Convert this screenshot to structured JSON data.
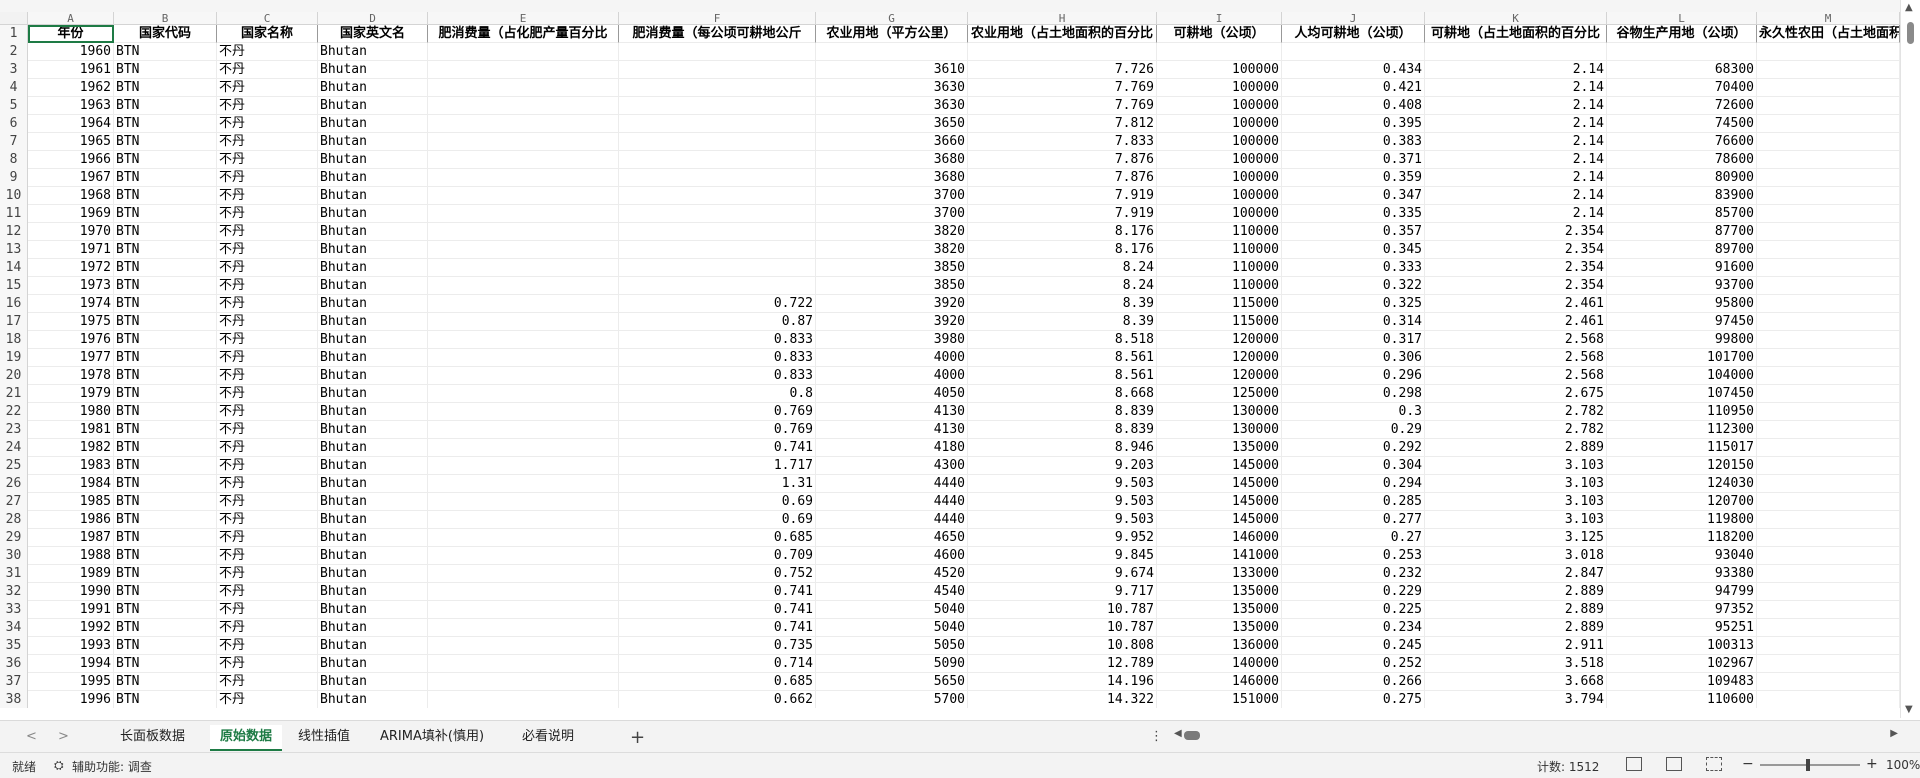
{
  "columns": {
    "letters": [
      "A",
      "B",
      "C",
      "D",
      "E",
      "F",
      "G",
      "H",
      "I",
      "J",
      "K",
      "L",
      "M"
    ],
    "headers": [
      "年份",
      "国家代码",
      "国家名称",
      "国家英文名",
      "肥消费量（占化肥产量百分比",
      "肥消费量（每公顷可耕地公斤",
      "农业用地（平方公里）",
      "农业用地（占土地面积的百分比",
      "可耕地（公顷）",
      "人均可耕地（公顷）",
      "可耕地（占土地面积的百分比",
      "谷物生产用地（公顷）",
      "永久性农田（占土地面积"
    ]
  },
  "rows": [
    [
      "1960",
      "BTN",
      "不丹",
      "Bhutan",
      "",
      "",
      "",
      "",
      "",
      "",
      "",
      "",
      ""
    ],
    [
      "1961",
      "BTN",
      "不丹",
      "Bhutan",
      "",
      "",
      "3610",
      "7.726",
      "100000",
      "0.434",
      "2.14",
      "68300",
      ""
    ],
    [
      "1962",
      "BTN",
      "不丹",
      "Bhutan",
      "",
      "",
      "3630",
      "7.769",
      "100000",
      "0.421",
      "2.14",
      "70400",
      ""
    ],
    [
      "1963",
      "BTN",
      "不丹",
      "Bhutan",
      "",
      "",
      "3630",
      "7.769",
      "100000",
      "0.408",
      "2.14",
      "72600",
      ""
    ],
    [
      "1964",
      "BTN",
      "不丹",
      "Bhutan",
      "",
      "",
      "3650",
      "7.812",
      "100000",
      "0.395",
      "2.14",
      "74500",
      ""
    ],
    [
      "1965",
      "BTN",
      "不丹",
      "Bhutan",
      "",
      "",
      "3660",
      "7.833",
      "100000",
      "0.383",
      "2.14",
      "76600",
      ""
    ],
    [
      "1966",
      "BTN",
      "不丹",
      "Bhutan",
      "",
      "",
      "3680",
      "7.876",
      "100000",
      "0.371",
      "2.14",
      "78600",
      ""
    ],
    [
      "1967",
      "BTN",
      "不丹",
      "Bhutan",
      "",
      "",
      "3680",
      "7.876",
      "100000",
      "0.359",
      "2.14",
      "80900",
      ""
    ],
    [
      "1968",
      "BTN",
      "不丹",
      "Bhutan",
      "",
      "",
      "3700",
      "7.919",
      "100000",
      "0.347",
      "2.14",
      "83900",
      ""
    ],
    [
      "1969",
      "BTN",
      "不丹",
      "Bhutan",
      "",
      "",
      "3700",
      "7.919",
      "100000",
      "0.335",
      "2.14",
      "85700",
      ""
    ],
    [
      "1970",
      "BTN",
      "不丹",
      "Bhutan",
      "",
      "",
      "3820",
      "8.176",
      "110000",
      "0.357",
      "2.354",
      "87700",
      ""
    ],
    [
      "1971",
      "BTN",
      "不丹",
      "Bhutan",
      "",
      "",
      "3820",
      "8.176",
      "110000",
      "0.345",
      "2.354",
      "89700",
      ""
    ],
    [
      "1972",
      "BTN",
      "不丹",
      "Bhutan",
      "",
      "",
      "3850",
      "8.24",
      "110000",
      "0.333",
      "2.354",
      "91600",
      ""
    ],
    [
      "1973",
      "BTN",
      "不丹",
      "Bhutan",
      "",
      "",
      "3850",
      "8.24",
      "110000",
      "0.322",
      "2.354",
      "93700",
      ""
    ],
    [
      "1974",
      "BTN",
      "不丹",
      "Bhutan",
      "",
      "0.722",
      "3920",
      "8.39",
      "115000",
      "0.325",
      "2.461",
      "95800",
      ""
    ],
    [
      "1975",
      "BTN",
      "不丹",
      "Bhutan",
      "",
      "0.87",
      "3920",
      "8.39",
      "115000",
      "0.314",
      "2.461",
      "97450",
      ""
    ],
    [
      "1976",
      "BTN",
      "不丹",
      "Bhutan",
      "",
      "0.833",
      "3980",
      "8.518",
      "120000",
      "0.317",
      "2.568",
      "99800",
      ""
    ],
    [
      "1977",
      "BTN",
      "不丹",
      "Bhutan",
      "",
      "0.833",
      "4000",
      "8.561",
      "120000",
      "0.306",
      "2.568",
      "101700",
      ""
    ],
    [
      "1978",
      "BTN",
      "不丹",
      "Bhutan",
      "",
      "0.833",
      "4000",
      "8.561",
      "120000",
      "0.296",
      "2.568",
      "104000",
      ""
    ],
    [
      "1979",
      "BTN",
      "不丹",
      "Bhutan",
      "",
      "0.8",
      "4050",
      "8.668",
      "125000",
      "0.298",
      "2.675",
      "107450",
      ""
    ],
    [
      "1980",
      "BTN",
      "不丹",
      "Bhutan",
      "",
      "0.769",
      "4130",
      "8.839",
      "130000",
      "0.3",
      "2.782",
      "110950",
      ""
    ],
    [
      "1981",
      "BTN",
      "不丹",
      "Bhutan",
      "",
      "0.769",
      "4130",
      "8.839",
      "130000",
      "0.29",
      "2.782",
      "112300",
      ""
    ],
    [
      "1982",
      "BTN",
      "不丹",
      "Bhutan",
      "",
      "0.741",
      "4180",
      "8.946",
      "135000",
      "0.292",
      "2.889",
      "115017",
      ""
    ],
    [
      "1983",
      "BTN",
      "不丹",
      "Bhutan",
      "",
      "1.717",
      "4300",
      "9.203",
      "145000",
      "0.304",
      "3.103",
      "120150",
      ""
    ],
    [
      "1984",
      "BTN",
      "不丹",
      "Bhutan",
      "",
      "1.31",
      "4440",
      "9.503",
      "145000",
      "0.294",
      "3.103",
      "124030",
      ""
    ],
    [
      "1985",
      "BTN",
      "不丹",
      "Bhutan",
      "",
      "0.69",
      "4440",
      "9.503",
      "145000",
      "0.285",
      "3.103",
      "120700",
      ""
    ],
    [
      "1986",
      "BTN",
      "不丹",
      "Bhutan",
      "",
      "0.69",
      "4440",
      "9.503",
      "145000",
      "0.277",
      "3.103",
      "119800",
      ""
    ],
    [
      "1987",
      "BTN",
      "不丹",
      "Bhutan",
      "",
      "0.685",
      "4650",
      "9.952",
      "146000",
      "0.27",
      "3.125",
      "118200",
      ""
    ],
    [
      "1988",
      "BTN",
      "不丹",
      "Bhutan",
      "",
      "0.709",
      "4600",
      "9.845",
      "141000",
      "0.253",
      "3.018",
      "93040",
      ""
    ],
    [
      "1989",
      "BTN",
      "不丹",
      "Bhutan",
      "",
      "0.752",
      "4520",
      "9.674",
      "133000",
      "0.232",
      "2.847",
      "93380",
      ""
    ],
    [
      "1990",
      "BTN",
      "不丹",
      "Bhutan",
      "",
      "0.741",
      "4540",
      "9.717",
      "135000",
      "0.229",
      "2.889",
      "94799",
      ""
    ],
    [
      "1991",
      "BTN",
      "不丹",
      "Bhutan",
      "",
      "0.741",
      "5040",
      "10.787",
      "135000",
      "0.225",
      "2.889",
      "97352",
      ""
    ],
    [
      "1992",
      "BTN",
      "不丹",
      "Bhutan",
      "",
      "0.741",
      "5040",
      "10.787",
      "135000",
      "0.234",
      "2.889",
      "95251",
      ""
    ],
    [
      "1993",
      "BTN",
      "不丹",
      "Bhutan",
      "",
      "0.735",
      "5050",
      "10.808",
      "136000",
      "0.245",
      "2.911",
      "100313",
      ""
    ],
    [
      "1994",
      "BTN",
      "不丹",
      "Bhutan",
      "",
      "0.714",
      "5090",
      "12.789",
      "140000",
      "0.252",
      "3.518",
      "102967",
      ""
    ],
    [
      "1995",
      "BTN",
      "不丹",
      "Bhutan",
      "",
      "0.685",
      "5650",
      "14.196",
      "146000",
      "0.266",
      "3.668",
      "109483",
      ""
    ],
    [
      "1996",
      "BTN",
      "不丹",
      "Bhutan",
      "",
      "0.662",
      "5700",
      "14.322",
      "151000",
      "0.275",
      "3.794",
      "110600",
      ""
    ]
  ],
  "tabs": [
    "长面板数据",
    "原始数据",
    "线性插值",
    "ARIMA填补(慎用)",
    "必看说明"
  ],
  "active_tab_index": 1,
  "status": {
    "ready": "就绪",
    "accessibility": "辅助功能: 调查",
    "count": "计数: 1512",
    "zoom": "100%"
  },
  "icons": {
    "add_tab": "plus-icon",
    "more_tabs": "more-vert-icon",
    "accessibility": "accessibility-icon"
  },
  "colors": {
    "accent": "#1e7b45"
  }
}
